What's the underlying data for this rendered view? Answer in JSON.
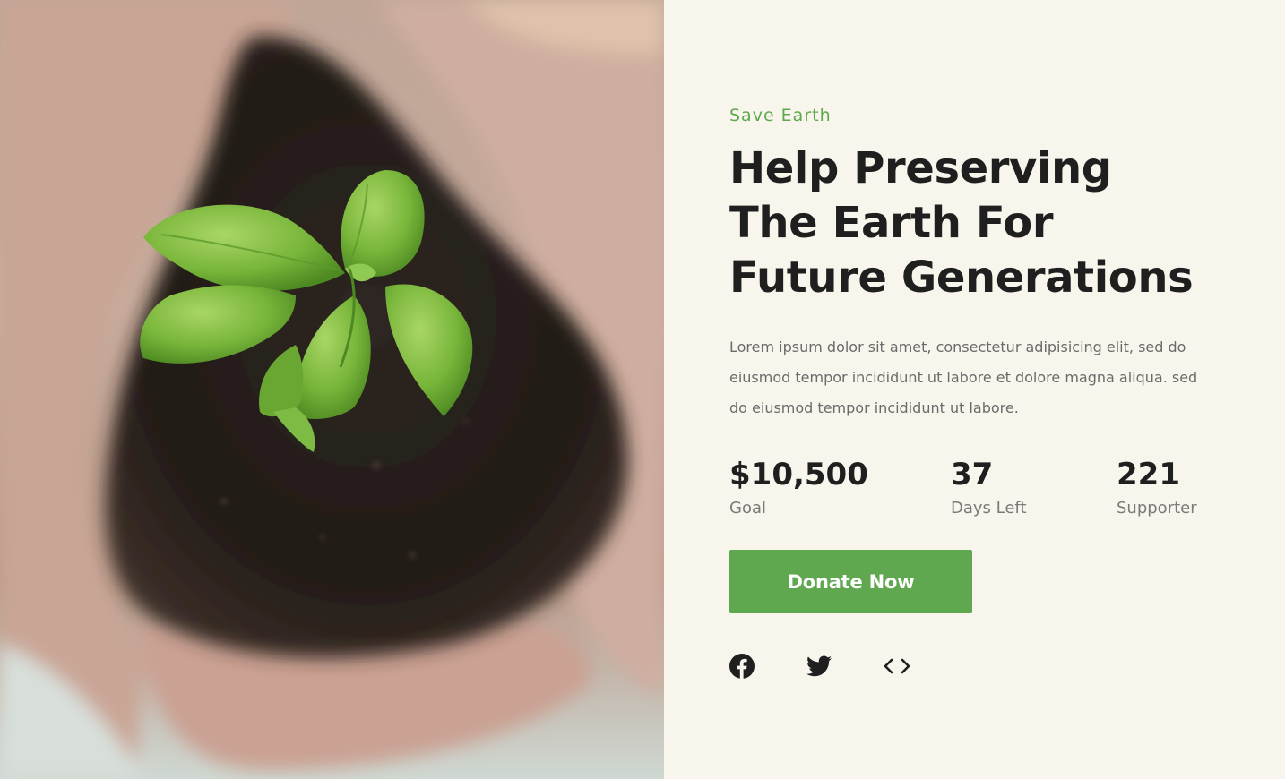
{
  "hero_image": {
    "alt_icon": "seedling-in-hands-photo"
  },
  "eyebrow": "Save Earth",
  "title": "Help Preserving The Earth For Future Generations",
  "description": "Lorem ipsum dolor sit amet, consectetur adipisicing elit, sed do eiusmod tempor incididunt ut labore et dolore magna aliqua. sed do eiusmod tempor incididunt ut labore.",
  "stats": [
    {
      "value": "$10,500",
      "label": "Goal"
    },
    {
      "value": "37",
      "label": "Days Left"
    },
    {
      "value": "221",
      "label": "Supporter"
    }
  ],
  "donate_label": "Donate Now",
  "social": [
    {
      "icon": "facebook-icon"
    },
    {
      "icon": "twitter-icon"
    },
    {
      "icon": "code-icon"
    }
  ],
  "colors": {
    "accent": "#60a84f",
    "background": "#f8f5ec",
    "text": "#1f1f1f"
  }
}
